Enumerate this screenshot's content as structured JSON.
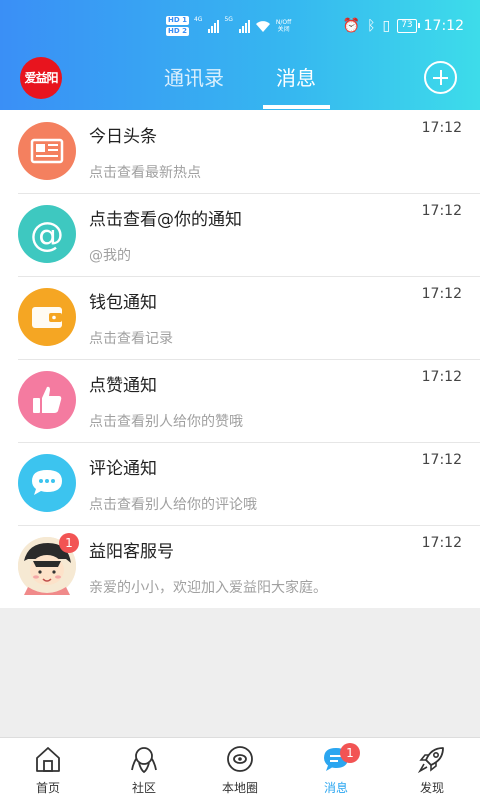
{
  "status_bar": {
    "time": "17:12",
    "battery": "73",
    "hd1": "HD 1",
    "hd2": "HD 2",
    "sig1": "4G",
    "sig2": "5G",
    "speed_line1": "N/Off",
    "speed_line2": "关闭"
  },
  "header": {
    "logo_text": "爱益阳",
    "tabs": [
      {
        "label": "通讯录",
        "active": false
      },
      {
        "label": "消息",
        "active": true
      }
    ],
    "add_icon": "plus-circle-icon"
  },
  "messages": [
    {
      "title": "今日头条",
      "subtitle": "点击查看最新热点",
      "time": "17:12",
      "icon": "newspaper-icon",
      "color": "#f4805f"
    },
    {
      "title": "点击查看@你的通知",
      "subtitle": "@我的",
      "time": "17:12",
      "icon": "at-icon",
      "color": "#3ec8c0"
    },
    {
      "title": "钱包通知",
      "subtitle": "点击查看记录",
      "time": "17:12",
      "icon": "wallet-icon",
      "color": "#f5a623"
    },
    {
      "title": "点赞通知",
      "subtitle": "点击查看别人给你的赞哦",
      "time": "17:12",
      "icon": "thumbs-up-icon",
      "color": "#f47ba0"
    },
    {
      "title": "评论通知",
      "subtitle": "点击查看别人给你的评论哦",
      "time": "17:12",
      "icon": "comment-icon",
      "color": "#3cc4ef"
    },
    {
      "title": "益阳客服号",
      "subtitle": "亲爱的小小，欢迎加入爱益阳大家庭。",
      "time": "17:12",
      "icon": "cartoon-avatar-icon",
      "badge": "1"
    }
  ],
  "bottom_nav": [
    {
      "label": "首页",
      "icon": "home-icon",
      "active": false
    },
    {
      "label": "社区",
      "icon": "community-icon",
      "active": false
    },
    {
      "label": "本地圈",
      "icon": "local-circle-icon",
      "active": false
    },
    {
      "label": "消息",
      "icon": "message-icon",
      "active": true,
      "badge": "1"
    },
    {
      "label": "发现",
      "icon": "rocket-icon",
      "active": false
    }
  ],
  "colors": {
    "header_start": "#3a8ff6",
    "header_end": "#3ddcea",
    "accent": "#2ba6f0",
    "badge": "#f25454"
  }
}
